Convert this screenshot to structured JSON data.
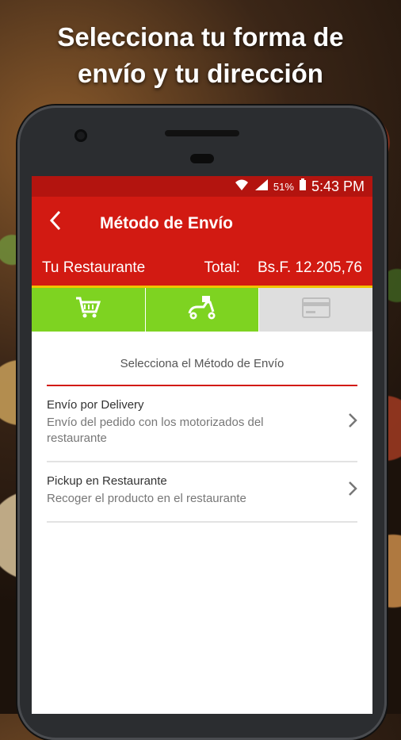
{
  "promo": {
    "headline_line1": "Selecciona tu forma de",
    "headline_line2": "envío y tu dirección"
  },
  "statusbar": {
    "battery": "51%",
    "time": "5:43 PM"
  },
  "appbar": {
    "back_icon": "chevron-left-icon",
    "title": "Método de Envío"
  },
  "order": {
    "restaurant": "Tu Restaurante",
    "total_label": "Total:",
    "total_value": "Bs.F. 12.205,76"
  },
  "steps": [
    {
      "icon": "cart-icon",
      "active": false
    },
    {
      "icon": "delivery-scooter-icon",
      "active": false
    },
    {
      "icon": "credit-card-icon",
      "active": true
    }
  ],
  "section_label": "Selecciona el Método de Envío",
  "options": [
    {
      "title": "Envío por Delivery",
      "subtitle": "Envío del pedido con los motorizados del restaurante"
    },
    {
      "title": "Pickup en Restaurante",
      "subtitle": "Recoger el producto en el restaurante"
    }
  ],
  "colors": {
    "primary_red": "#d21a12",
    "status_red": "#b3140f",
    "step_green": "#7ed321",
    "accent_yellow": "#f3c200"
  }
}
